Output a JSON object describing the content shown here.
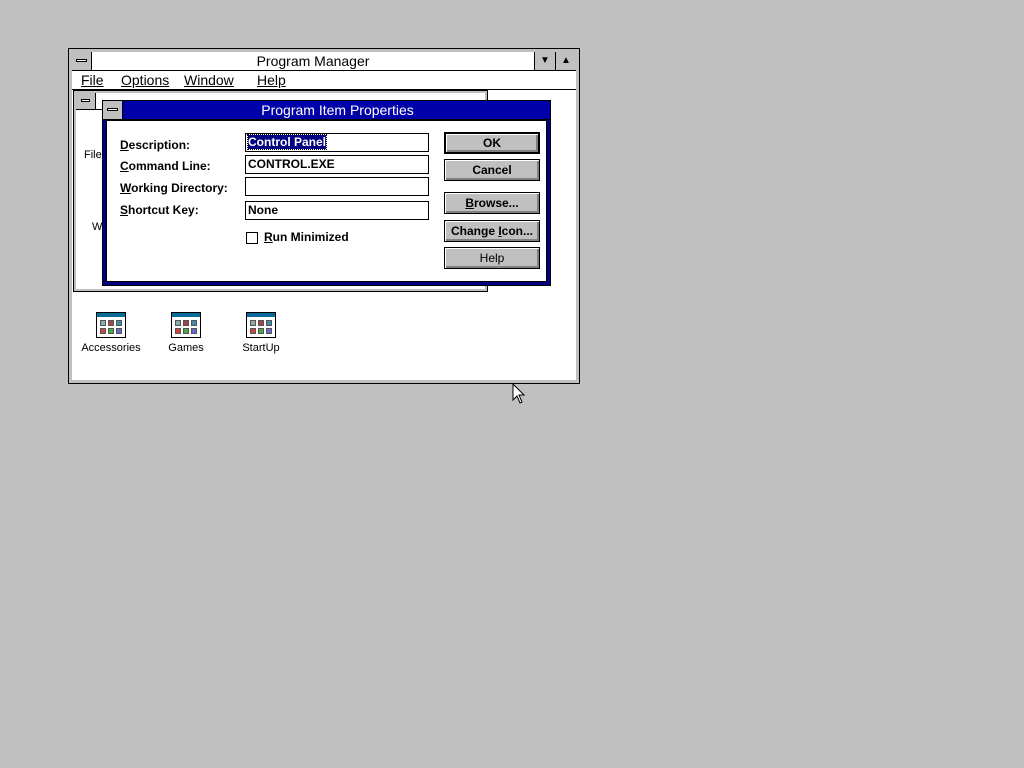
{
  "program_manager": {
    "title": "Program Manager",
    "menu": [
      "File",
      "Options",
      "Window",
      "Help"
    ],
    "minimize_glyph": "▼",
    "maximize_glyph": "▲"
  },
  "group_window": {
    "partial_text_left": "File",
    "partial_text_left2": "W"
  },
  "groups": [
    {
      "label": "Accessories"
    },
    {
      "label": "Games"
    },
    {
      "label": "StartUp"
    }
  ],
  "dialog": {
    "title": "Program Item Properties",
    "fields": {
      "description_label": "Description:",
      "description_value": "Control Panel",
      "command_label": "Command Line:",
      "command_value": "CONTROL.EXE",
      "workdir_label": "Working Directory:",
      "workdir_value": "",
      "shortcut_label": "Shortcut Key:",
      "shortcut_value": "None"
    },
    "run_minimized_label": "Run Minimized",
    "run_minimized_checked": false,
    "buttons": {
      "ok": "OK",
      "cancel": "Cancel",
      "browse": "Browse...",
      "change_icon": "Change Icon...",
      "help": "Help"
    }
  },
  "colors": {
    "desktop": "#c0c0c0",
    "active_title": "#0000a8",
    "selection": "#000080"
  }
}
